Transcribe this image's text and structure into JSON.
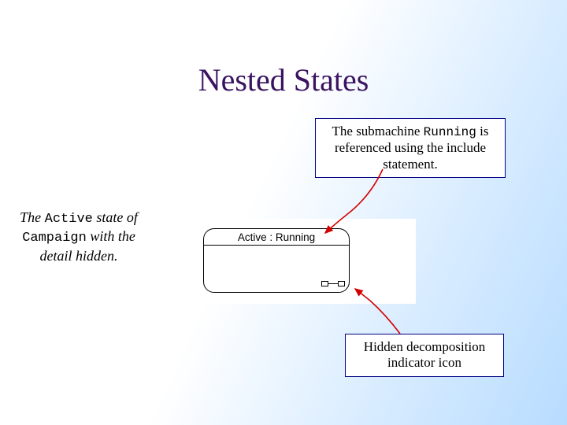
{
  "title": "Nested States",
  "callout_top": {
    "pre": "The submachine ",
    "code": "Running",
    "post": " is referenced using the include statement."
  },
  "callout_bottom": "Hidden decomposition indicator icon",
  "leftnote": {
    "t1": "The ",
    "c1": "Active",
    "t2": " state of ",
    "c2": "Campaign",
    "t3": " with the detail hidden."
  },
  "state_label": "Active : Running"
}
